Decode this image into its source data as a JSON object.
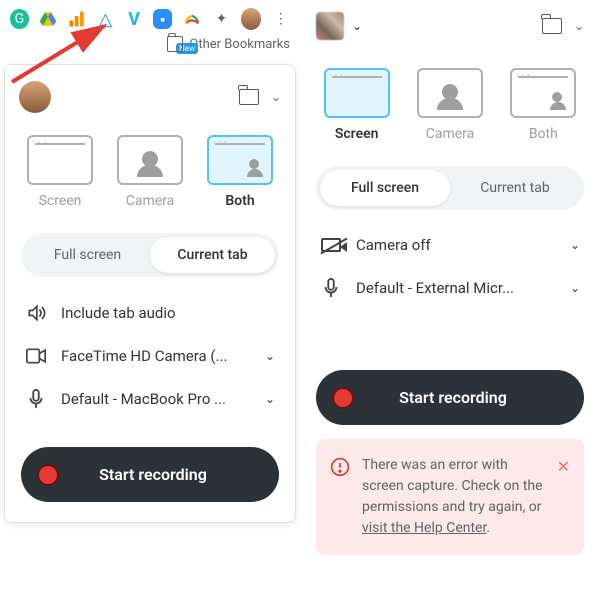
{
  "bookmarks_bar": {
    "other_bookmarks": "Other Bookmarks"
  },
  "ext_badge_new": "New",
  "left_panel": {
    "modes": {
      "screen": "Screen",
      "camera": "Camera",
      "both": "Both",
      "selected": "both"
    },
    "segment": {
      "full_screen": "Full screen",
      "current_tab": "Current tab",
      "selected": "current_tab"
    },
    "options": {
      "tab_audio": "Include tab audio",
      "camera": "FaceTime HD Camera (...",
      "mic": "Default - MacBook Pro ..."
    },
    "start": "Start recording"
  },
  "right_panel": {
    "modes": {
      "screen": "Screen",
      "camera": "Camera",
      "both": "Both",
      "selected": "screen"
    },
    "segment": {
      "full_screen": "Full screen",
      "current_tab": "Current tab",
      "selected": "full_screen"
    },
    "options": {
      "camera": "Camera off",
      "mic": "Default - External Micr..."
    },
    "start": "Start recording",
    "error": {
      "text_a": "There was an error with screen capture. Check on the permissions and try again, or ",
      "link": "visit the Help Center",
      "text_b": "."
    }
  }
}
